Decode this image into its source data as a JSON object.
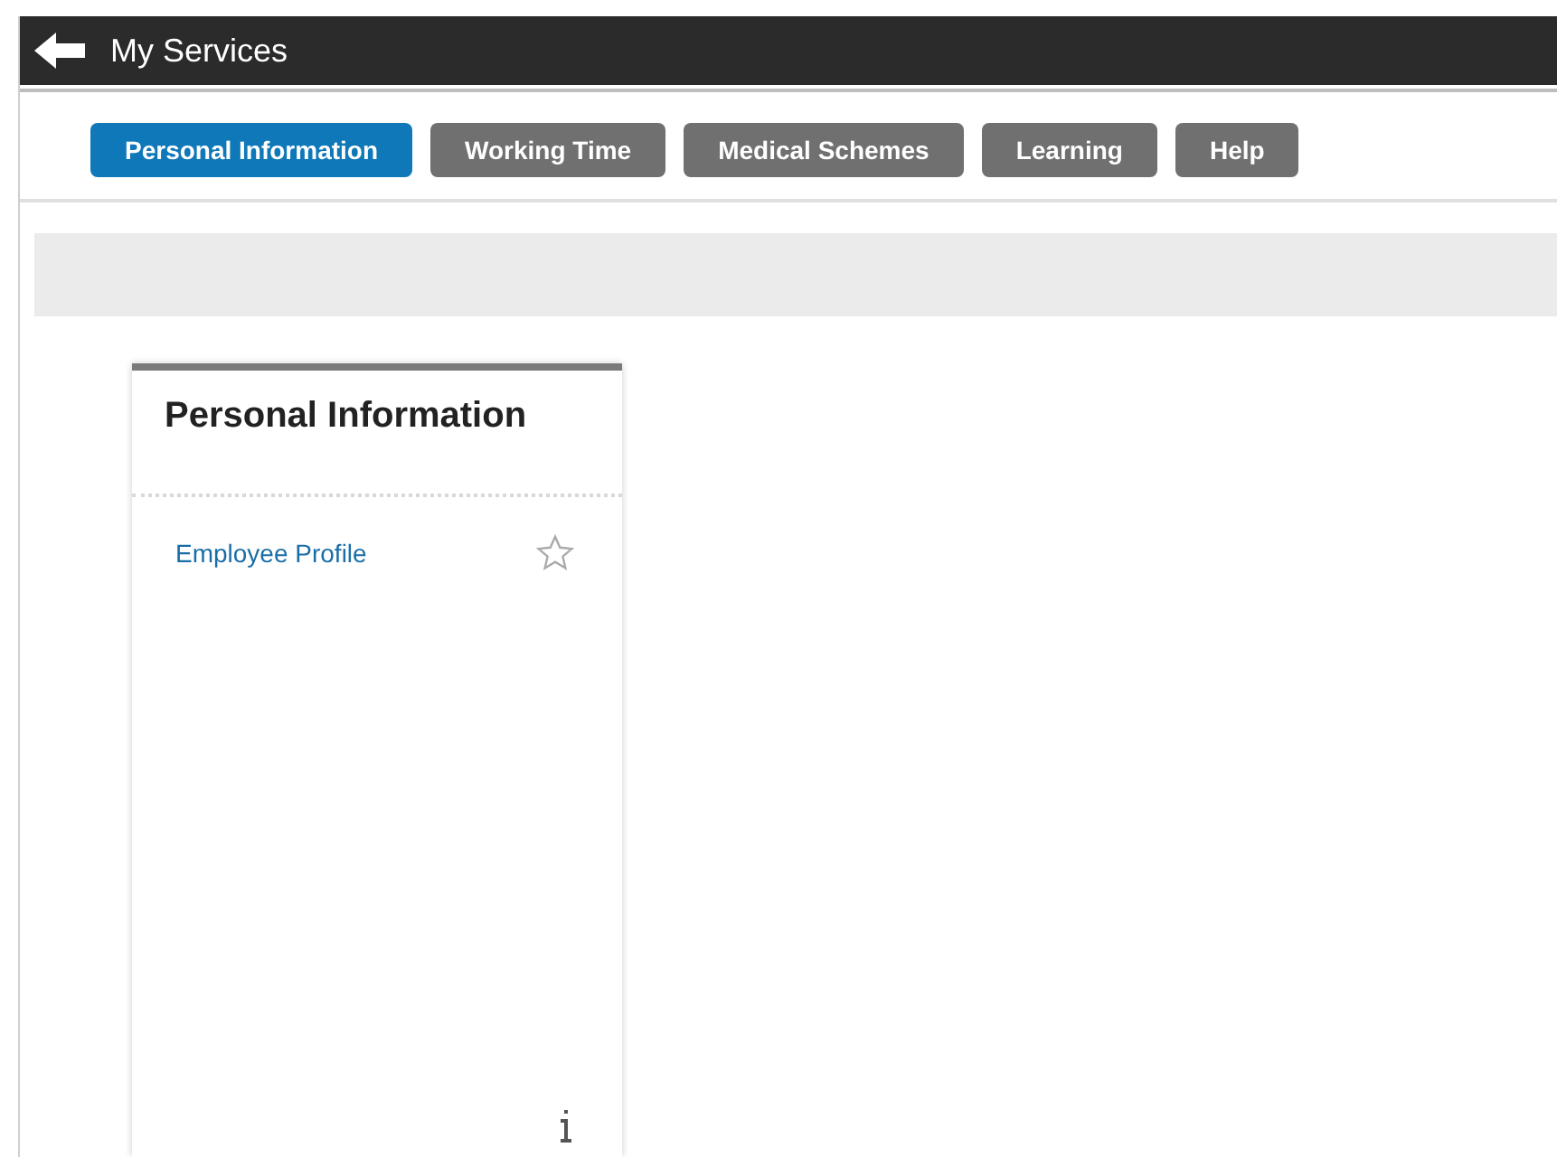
{
  "header": {
    "title": "My Services"
  },
  "tabs": [
    {
      "label": "Personal Information",
      "selected": true
    },
    {
      "label": "Working Time",
      "selected": false
    },
    {
      "label": "Medical Schemes",
      "selected": false
    },
    {
      "label": "Learning",
      "selected": false
    },
    {
      "label": "Help",
      "selected": false
    }
  ],
  "card": {
    "title": "Personal Information",
    "items": [
      {
        "label": "Employee Profile",
        "favorite": false
      }
    ]
  }
}
